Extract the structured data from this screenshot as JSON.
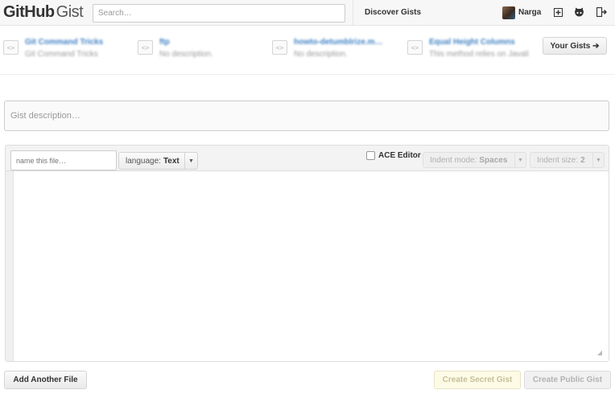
{
  "header": {
    "logo_bold": "GitHub",
    "logo_light": "Gist",
    "search_placeholder": "Search…",
    "discover": "Discover Gists",
    "username": "Narga"
  },
  "recent_gists": [
    {
      "title": "Git Command Tricks",
      "desc": "Git Command Tricks"
    },
    {
      "title": "ftp",
      "desc": "No description."
    },
    {
      "title": "howto-detumblrize.m…",
      "desc": "No description."
    },
    {
      "title": "Equal Height Columns",
      "desc": "This method relies on Javali"
    }
  ],
  "your_gists": "Your Gists ➔",
  "description_placeholder": "Gist description…",
  "file": {
    "name_placeholder": "name this file…",
    "language_label": "language:",
    "language_value": "Text",
    "ace_label": "ACE Editor",
    "indent_mode_label": "Indent mode:",
    "indent_mode_value": "Spaces",
    "indent_size_label": "Indent size:",
    "indent_size_value": "2"
  },
  "buttons": {
    "add_file": "Add Another File",
    "secret": "Create Secret Gist",
    "public": "Create Public Gist"
  },
  "colors": {
    "link": "#4183c4",
    "header_bg": "#f7f7f7"
  }
}
